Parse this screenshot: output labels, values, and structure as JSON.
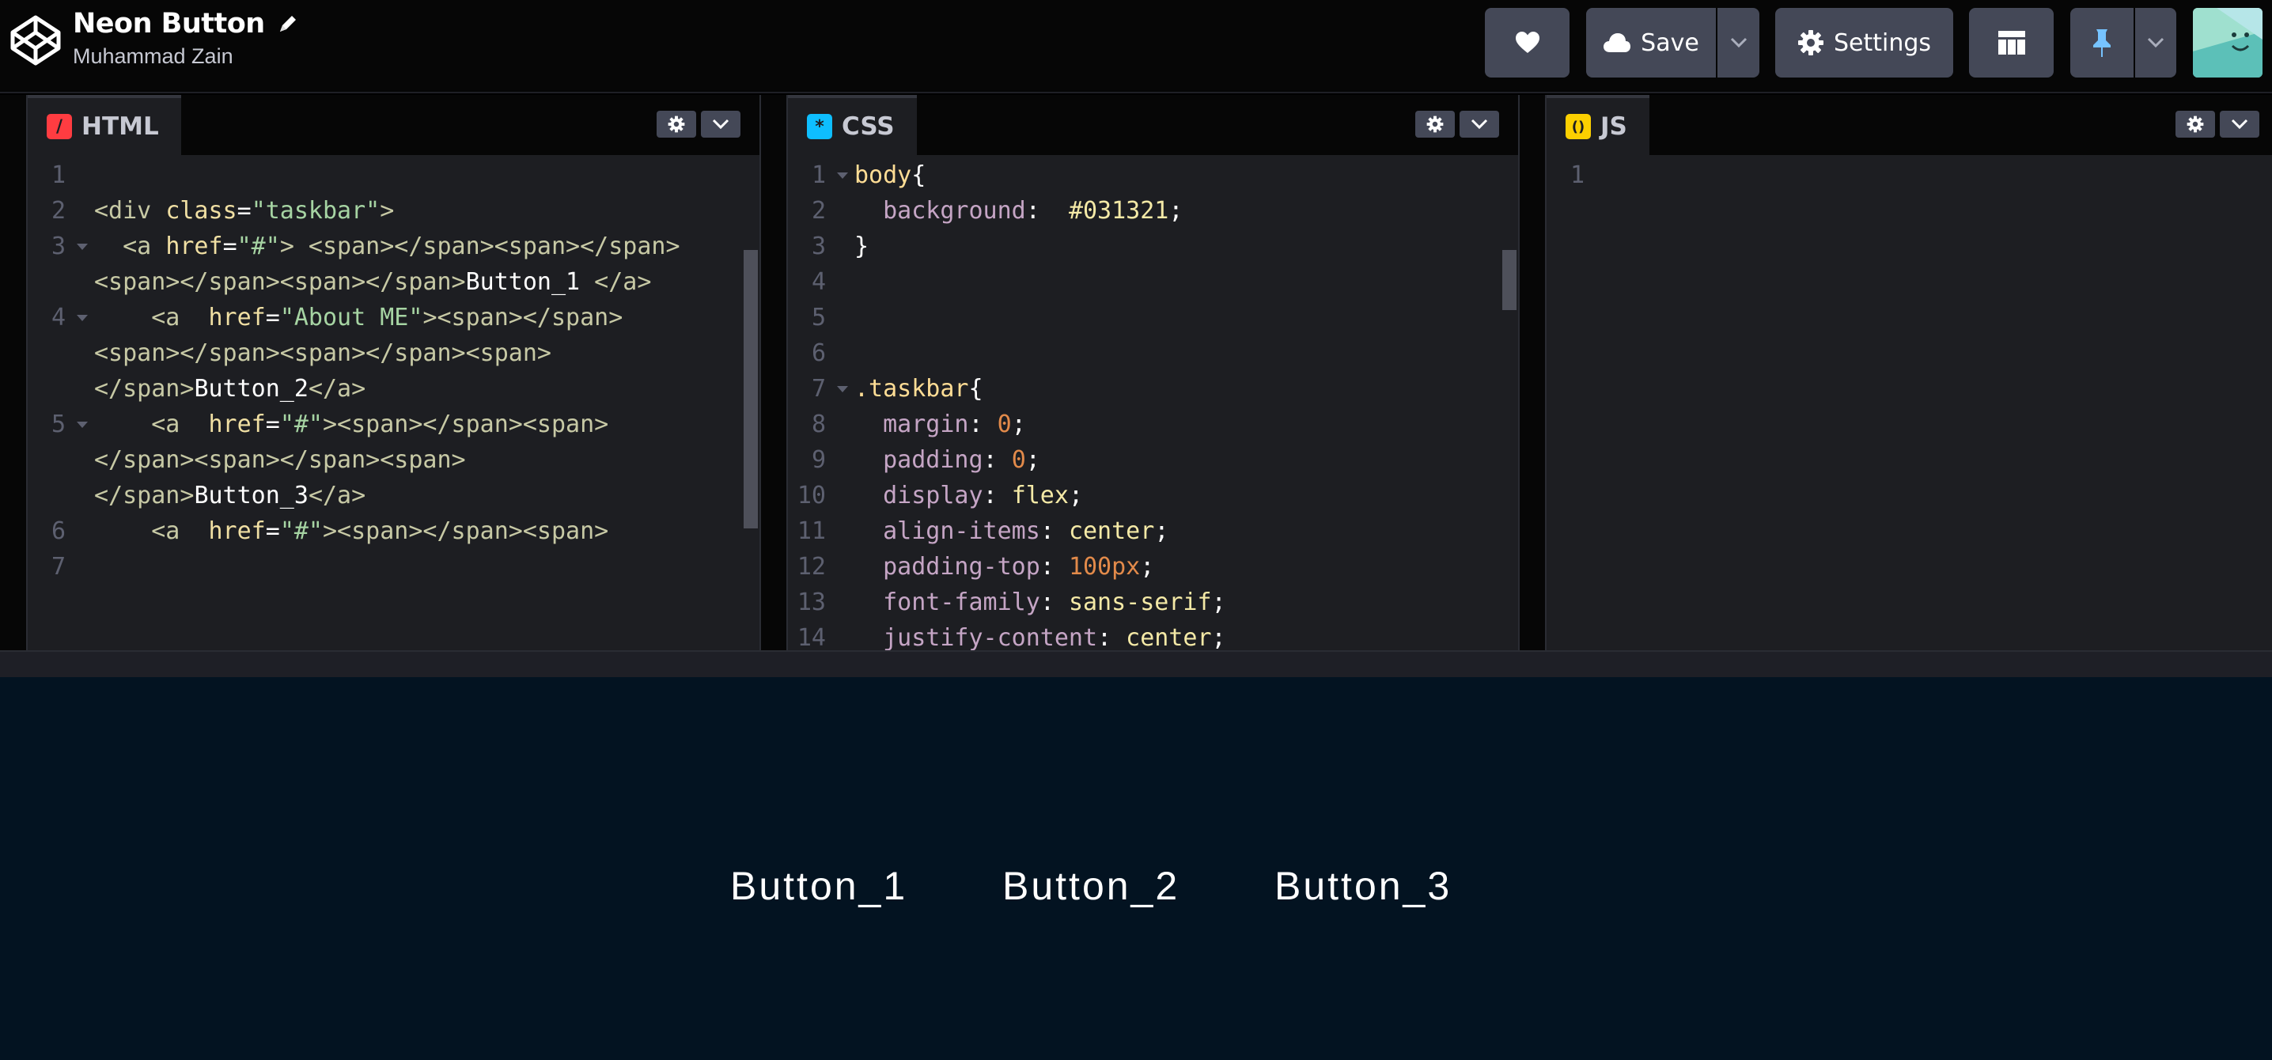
{
  "header": {
    "title": "Neon Button",
    "author": "Muhammad Zain",
    "save_label": "Save",
    "settings_label": "Settings"
  },
  "panes": {
    "html": {
      "label": "HTML",
      "icon_glyph": "/",
      "icon_color": "#ff3c41"
    },
    "css": {
      "label": "CSS",
      "icon_glyph": "*",
      "icon_color": "#0ebeff"
    },
    "js": {
      "label": "JS",
      "icon_glyph": "()",
      "icon_color": "#fcd000"
    }
  },
  "html_code": {
    "l1": "1",
    "l2": "2",
    "l3": "3",
    "l4": "4",
    "l5": "5",
    "l6": "6",
    "l7": "7",
    "div_open": "<div ",
    "class_attr": "class",
    "eq": "=",
    "taskbar_str": "\"taskbar\"",
    "close_gt": ">",
    "l3_a": "  <a ",
    "href": "href",
    "hash": "\"#\"",
    "l3_span": "> <span></span><span></span>",
    "l3b": "<span></span><span></span>",
    "btn1": "Button_1 ",
    "a_close": "</a>",
    "l4_a": "    <a  ",
    "about": "\"About ME\"",
    "l4_span": "><span></span>",
    "l4b": "<span></span><span></span><span>",
    "l4c_tag": "</span>",
    "btn2": "Button_2",
    "a_close2": "</a>",
    "l5_a": "    <a  ",
    "l5_span": "><span></span><span>",
    "l5b": "</span><span></span><span>",
    "l5c_tag": "</span>",
    "btn3": "Button_3",
    "a_close3": "</a>",
    "l6_a": "    <a  ",
    "l6_span": "><span></span><span>"
  },
  "css_code": {
    "n1": "1",
    "n2": "2",
    "n3": "3",
    "n4": "4",
    "n5": "5",
    "n6": "6",
    "n7": "7",
    "n8": "8",
    "n9": "9",
    "n10": "10",
    "n11": "11",
    "n12": "12",
    "n13": "13",
    "n14": "14",
    "body": "body",
    "brace_open": "{",
    "background": "  background",
    "colon_sp": ":  ",
    "bg_val": "#031321",
    "semi": ";",
    "brace_close": "}",
    "taskbar_sel": ".taskbar",
    "brace_open2": "{",
    "margin": "  margin",
    "colon": ": ",
    "zero": "0",
    "semi2": ";",
    "padding": "  padding",
    "zero2": "0",
    "semi3": ";",
    "display": "  display",
    "flex": "flex",
    "semi4": ";",
    "align": "  align-items",
    "center": "center",
    "semi5": ";",
    "ptop": "  padding-top",
    "px100": "100px",
    "semi6": ";",
    "ffam": "  font-family",
    "sans": "sans-serif",
    "semi7": ";",
    "justify": "  justify-content",
    "center2": "center",
    "semi8": ";"
  },
  "js_code": {
    "n1": "1"
  },
  "preview": {
    "buttons": [
      "Button_1",
      "Button_2",
      "Button_3"
    ],
    "background": "#031321"
  }
}
